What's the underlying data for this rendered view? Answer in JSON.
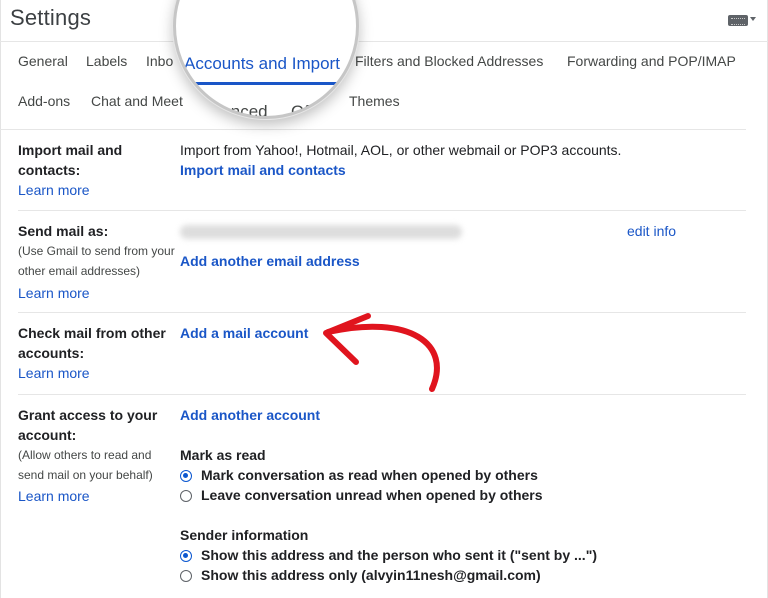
{
  "header": {
    "title": "Settings"
  },
  "tabs_row1": [
    "General",
    "Labels",
    "Inbo",
    "Filters and Blocked Addresses",
    "Forwarding and POP/IMAP"
  ],
  "tabs_row2": [
    "Add-ons",
    "Chat and Meet",
    "Themes"
  ],
  "magnifier": {
    "active_tab": "Accounts and Import",
    "tab_advanced": "Advanced",
    "tab_offline": "Offline"
  },
  "import": {
    "label": "Import mail and contacts:",
    "learn_more": "Learn more",
    "description": "Import from Yahoo!, Hotmail, AOL, or other webmail or POP3 accounts.",
    "action": "Import mail and contacts"
  },
  "send_as": {
    "label": "Send mail as:",
    "sub": "(Use Gmail to send from your other email addresses)",
    "learn_more": "Learn more",
    "edit_info": "edit info",
    "action": "Add another email address"
  },
  "check_mail": {
    "label": "Check mail from other accounts:",
    "learn_more": "Learn more",
    "action": "Add a mail account"
  },
  "grant": {
    "label": "Grant access to your account:",
    "sub": "(Allow others to read and send mail on your behalf)",
    "learn_more": "Learn more",
    "action": "Add another account",
    "mark_as_read": {
      "title": "Mark as read",
      "options": [
        "Mark conversation as read when opened by others",
        "Leave conversation unread when opened by others"
      ],
      "selected": 0
    },
    "sender_info": {
      "title": "Sender information",
      "options": [
        "Show this address and the person who sent it (\"sent by ...\")",
        "Show this address only (alvyin11nesh@gmail.com)"
      ],
      "selected": 0
    }
  },
  "colors": {
    "link": "#1a56c7",
    "radio_selected": "#0b57d0",
    "annotation_arrow": "#e0141e"
  }
}
